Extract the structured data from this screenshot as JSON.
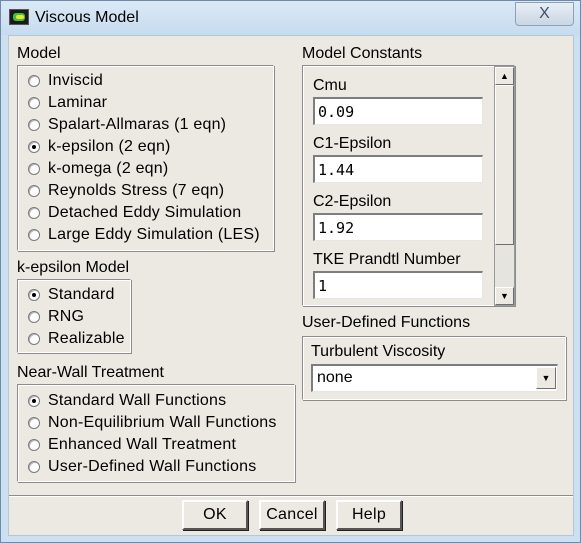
{
  "window": {
    "title": "Viscous Model",
    "close_label": "X"
  },
  "model": {
    "label": "Model",
    "options": [
      {
        "label": "Inviscid",
        "selected": false
      },
      {
        "label": "Laminar",
        "selected": false
      },
      {
        "label": "Spalart-Allmaras  (1 eqn)",
        "selected": false
      },
      {
        "label": "k-epsilon  (2 eqn)",
        "selected": true
      },
      {
        "label": "k-omega  (2 eqn)",
        "selected": false
      },
      {
        "label": "Reynolds Stress  (7 eqn)",
        "selected": false
      },
      {
        "label": "Detached Eddy Simulation",
        "selected": false
      },
      {
        "label": "Large Eddy Simulation (LES)",
        "selected": false
      }
    ]
  },
  "kepsilon_model": {
    "label": "k-epsilon Model",
    "options": [
      {
        "label": "Standard",
        "selected": true
      },
      {
        "label": "RNG",
        "selected": false
      },
      {
        "label": "Realizable",
        "selected": false
      }
    ]
  },
  "near_wall": {
    "label": "Near-Wall Treatment",
    "options": [
      {
        "label": "Standard Wall Functions",
        "selected": true
      },
      {
        "label": "Non-Equilibrium Wall Functions",
        "selected": false
      },
      {
        "label": "Enhanced Wall Treatment",
        "selected": false
      },
      {
        "label": "User-Defined Wall Functions",
        "selected": false
      }
    ]
  },
  "constants": {
    "label": "Model Constants",
    "fields": [
      {
        "label": "Cmu",
        "value": "0.09"
      },
      {
        "label": "C1-Epsilon",
        "value": "1.44"
      },
      {
        "label": "C2-Epsilon",
        "value": "1.92"
      },
      {
        "label": "TKE Prandtl Number",
        "value": "1"
      }
    ]
  },
  "udf": {
    "label": "User-Defined Functions",
    "turbulent_viscosity_label": "Turbulent Viscosity",
    "turbulent_viscosity_value": "none"
  },
  "buttons": {
    "ok": "OK",
    "cancel": "Cancel",
    "help": "Help"
  },
  "icons": {
    "scroll_up": "▲",
    "scroll_down": "▼",
    "dropdown": "▼"
  }
}
